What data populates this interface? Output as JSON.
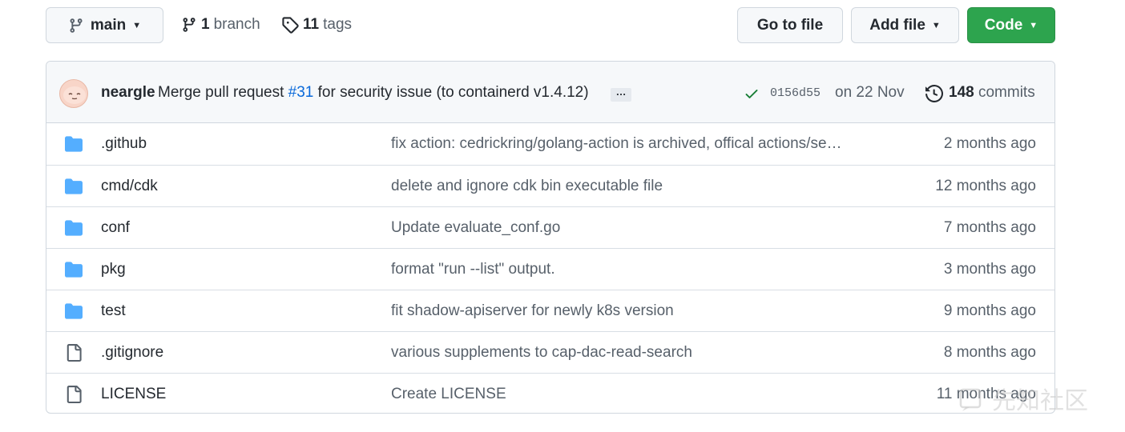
{
  "toolbar": {
    "branch_name": "main",
    "branches_count": "1",
    "branches_label": "branch",
    "tags_count": "11",
    "tags_label": "tags",
    "go_to_file_label": "Go to file",
    "add_file_label": "Add file",
    "code_label": "Code",
    "code_color": "#2da44e"
  },
  "latest_commit": {
    "author": "neargle",
    "message_before": "Merge pull request ",
    "pr_ref": "#31",
    "message_after": " for security issue (to containerd v1.4.12)",
    "ellipsis": "…",
    "status_icon": "check-icon",
    "sha": "0156d55",
    "date": "on 22 Nov",
    "commits_count": "148",
    "commits_label": "commits"
  },
  "files": [
    {
      "type": "folder-icon",
      "name": ".github",
      "message": "fix action: cedrickring/golang-action is archived, offical actions/se…",
      "age": "2 months ago"
    },
    {
      "type": "folder-icon",
      "name": "cmd/cdk",
      "message": "delete and ignore cdk bin executable file",
      "age": "12 months ago"
    },
    {
      "type": "folder-icon",
      "name": "conf",
      "message": "Update evaluate_conf.go",
      "age": "7 months ago"
    },
    {
      "type": "folder-icon",
      "name": "pkg",
      "message": "format \"run --list\" output.",
      "age": "3 months ago"
    },
    {
      "type": "folder-icon",
      "name": "test",
      "message": "fit shadow-apiserver for newly k8s version",
      "age": "9 months ago"
    },
    {
      "type": "file-icon",
      "name": ".gitignore",
      "message": "various supplements to cap-dac-read-search",
      "age": "8 months ago"
    },
    {
      "type": "file-icon",
      "name": "LICENSE",
      "message": "Create LICENSE",
      "age": "11 months ago"
    }
  ],
  "watermark_text": "先知社区",
  "colors": {
    "folder": "#54aeff",
    "link": "#0969da",
    "success": "#1a7f37"
  }
}
